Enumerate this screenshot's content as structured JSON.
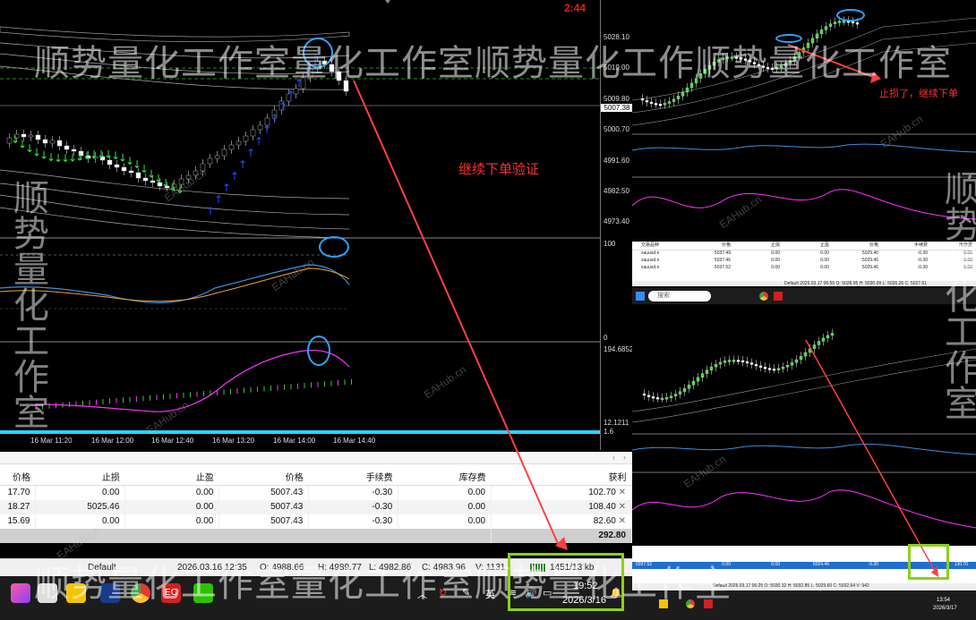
{
  "chart": {
    "red_time": "2:44",
    "price_labels": [
      "5028.10",
      "5019.00",
      "5009.80",
      "5000.70",
      "4991.60",
      "4982.50",
      "4973.40"
    ],
    "current_price": "5007.38",
    "rsi_labels": [
      "100",
      "0"
    ],
    "ind_labels": [
      "194.6852",
      "12.1211",
      "1.6"
    ],
    "time_labels": [
      "16 Mar 11:20",
      "16 Mar 12:00",
      "16 Mar 12:40",
      "16 Mar 13:20",
      "16 Mar 14:00",
      "16 Mar 14:40"
    ]
  },
  "annotations": {
    "main": "继续下单验证",
    "right": "止损了，继续下单"
  },
  "watermarks": {
    "big": "顺势量化工作室量化工作室顺势量化工作顺势量化工作室",
    "big_bottom": "顺势量化工作室量化工作室顺势量化工作室",
    "vertical_left": "顺势量化工作室",
    "vertical_right": "顺势量化工作室",
    "small": "EAHub.cn"
  },
  "orders": {
    "headers": [
      "价格",
      "止损",
      "止盈",
      "价格",
      "手续费",
      "库存费",
      "获利"
    ],
    "rows": [
      [
        "17.70",
        "0.00",
        "0.00",
        "5007.43",
        "-0.30",
        "0.00",
        "102.70"
      ],
      [
        "18.27",
        "5025.46",
        "0.00",
        "5007.43",
        "-0.30",
        "0.00",
        "108.40"
      ],
      [
        "15.69",
        "0.00",
        "0.00",
        "5007.43",
        "-0.30",
        "0.00",
        "82.60"
      ]
    ],
    "total": "292.80"
  },
  "statusbar": {
    "profile": "Default",
    "datetime": "2026.03.16 12:35",
    "open": "O: 4988.66",
    "high": "H: 4989.77",
    "low": "L: 4982.86",
    "close": "C: 4983.96",
    "volume": "V: 1131",
    "traffic": "1451/13 kb"
  },
  "taskbar": {
    "ime": "英",
    "time": "19:52",
    "date": "2026/3/16"
  },
  "right_top": {
    "search_placeholder": "搜索",
    "table_headers": [
      "交易品种",
      "价格",
      "止损",
      "止盈",
      "价格",
      "手续费",
      "库存费"
    ],
    "table_rows": [
      [
        "xauusd.n",
        "5037.49",
        "0.00",
        "0.00",
        "5029.46",
        "-0.30",
        "0.00"
      ],
      [
        "xauusd.n",
        "5037.46",
        "0.00",
        "0.00",
        "5029.46",
        "-0.30",
        "0.00"
      ],
      [
        "xauusd.n",
        "5037.52",
        "0.00",
        "0.00",
        "5029.46",
        "-0.30",
        "0.00"
      ]
    ],
    "status": "Default     2026.03.17 06:55   O: 5028.95   H: 5030.09   L: 5026.26   C: 5027.61"
  },
  "right_bottom": {
    "status": "Default     2026.03.17 06:25   O: 5030.32   H: 5032.85   L: 5029.60   C: 5032.64   V: 942",
    "time": "13:54",
    "date": "2026/3/17",
    "row_values": [
      "5037.52",
      "0.00",
      "0.00",
      "5024.46",
      "-0.30",
      "130.70"
    ]
  }
}
